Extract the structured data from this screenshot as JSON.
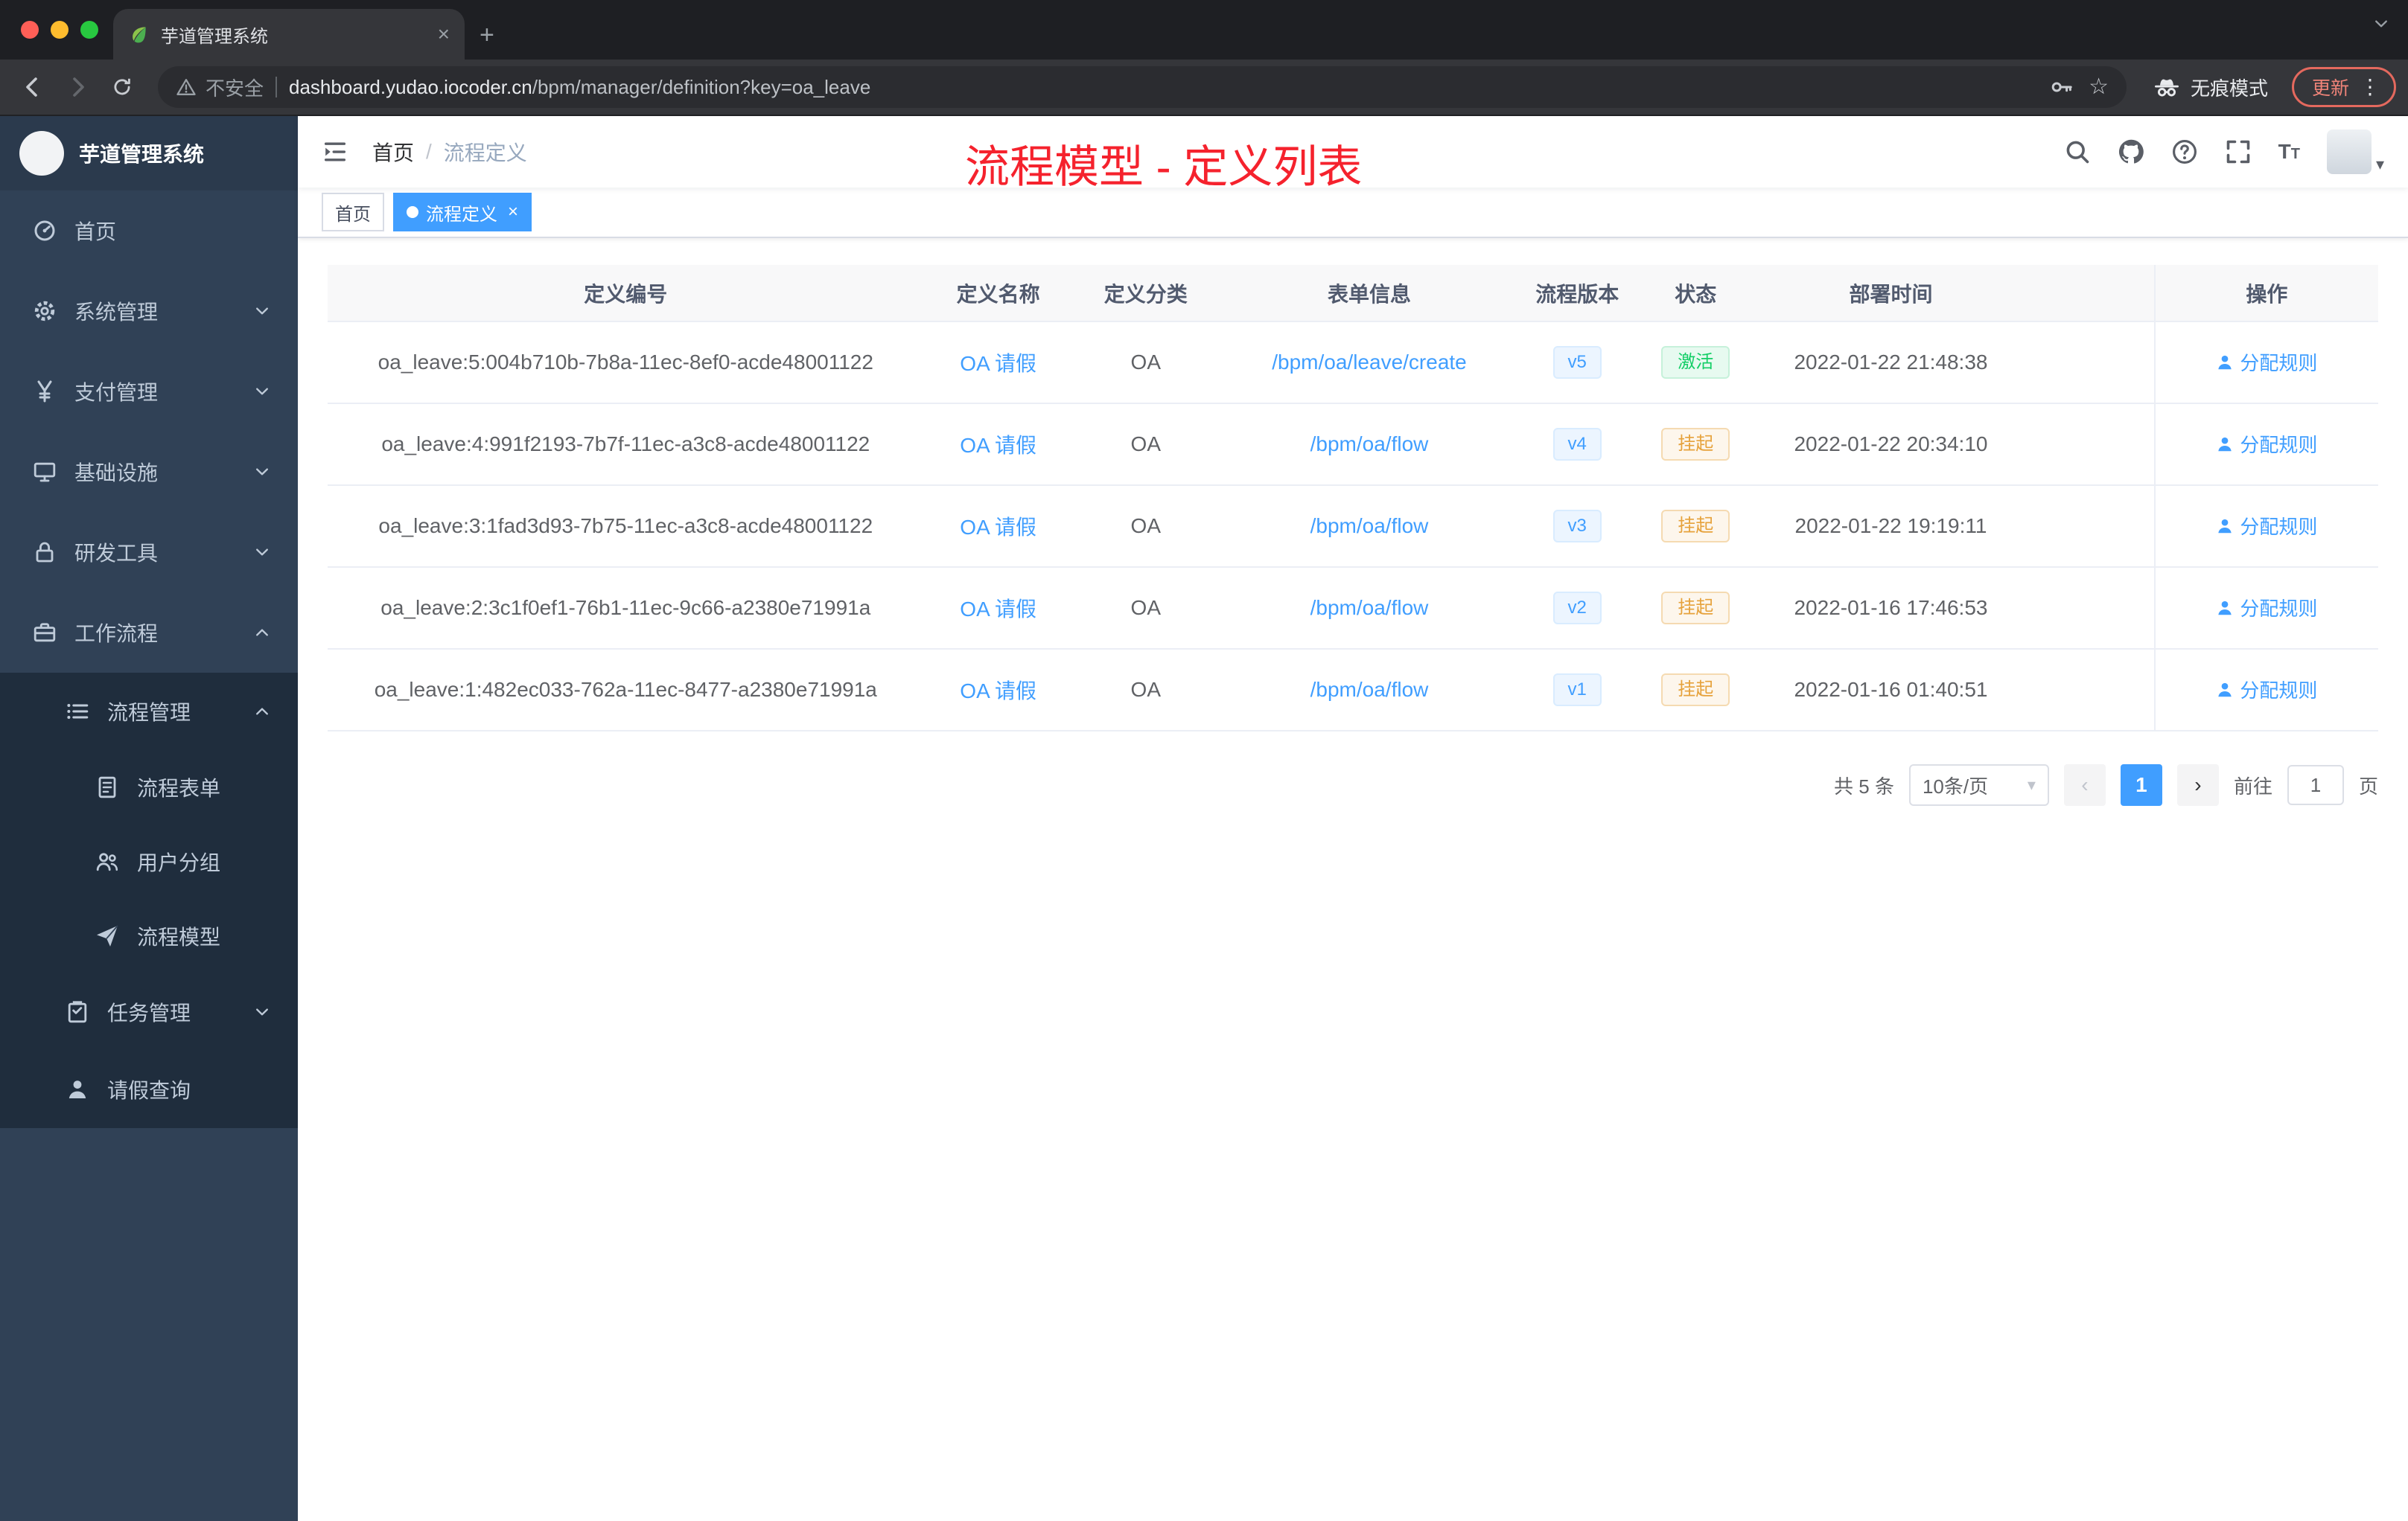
{
  "glyphs": {
    "close": "×",
    "plus": "+",
    "dots": "⋮",
    "star": "☆",
    "caret": "▾",
    "slash": "/",
    "prev": "‹",
    "next": "›",
    "t_big": "T",
    "t_small": "T"
  },
  "browser": {
    "tab_title": "芋道管理系统",
    "security": "不安全",
    "url_host": "dashboard.yudao.iocoder.cn",
    "url_path": "/bpm/manager/definition?key=oa_leave",
    "incognito": "无痕模式",
    "update": "更新"
  },
  "sidebar": {
    "logo_title": "芋道管理系统",
    "menu": [
      {
        "label": "首页",
        "icon": "dashboard-icon"
      },
      {
        "label": "系统管理",
        "icon": "gear-icon"
      },
      {
        "label": "支付管理",
        "icon": "yen-icon"
      },
      {
        "label": "基础设施",
        "icon": "infra-icon"
      },
      {
        "label": "研发工具",
        "icon": "tools-icon"
      },
      {
        "label": "工作流程",
        "icon": "workflow-icon"
      }
    ],
    "sub": [
      {
        "label": "流程管理",
        "icon": "list-icon"
      },
      {
        "label": "流程表单",
        "icon": "form-icon"
      },
      {
        "label": "用户分组",
        "icon": "users-icon"
      },
      {
        "label": "流程模型",
        "icon": "send-icon"
      },
      {
        "label": "任务管理",
        "icon": "task-icon"
      },
      {
        "label": "请假查询",
        "icon": "person-icon"
      }
    ]
  },
  "nav": {
    "breadcrumb_home": "首页",
    "breadcrumb_current": "流程定义"
  },
  "annotation": {
    "text": "流程模型 - 定义列表",
    "color": "#f5222d"
  },
  "tags": {
    "home": "首页",
    "active": "流程定义"
  },
  "table": {
    "columns": [
      "定义编号",
      "定义名称",
      "定义分类",
      "表单信息",
      "流程版本",
      "状态",
      "部署时间",
      "操作"
    ],
    "rows": [
      {
        "id": "oa_leave:5:004b710b-7b8a-11ec-8ef0-acde48001122",
        "name": "OA 请假",
        "category": "OA",
        "form": "/bpm/oa/leave/create",
        "version": "v5",
        "status": "激活",
        "status_type": "success",
        "time": "2022-01-22 21:48:38",
        "action": "分配规则"
      },
      {
        "id": "oa_leave:4:991f2193-7b7f-11ec-a3c8-acde48001122",
        "name": "OA 请假",
        "category": "OA",
        "form": "/bpm/oa/flow",
        "version": "v4",
        "status": "挂起",
        "status_type": "warning",
        "time": "2022-01-22 20:34:10",
        "action": "分配规则"
      },
      {
        "id": "oa_leave:3:1fad3d93-7b75-11ec-a3c8-acde48001122",
        "name": "OA 请假",
        "category": "OA",
        "form": "/bpm/oa/flow",
        "version": "v3",
        "status": "挂起",
        "status_type": "warning",
        "time": "2022-01-22 19:19:11",
        "action": "分配规则"
      },
      {
        "id": "oa_leave:2:3c1f0ef1-76b1-11ec-9c66-a2380e71991a",
        "name": "OA 请假",
        "category": "OA",
        "form": "/bpm/oa/flow",
        "version": "v2",
        "status": "挂起",
        "status_type": "warning",
        "time": "2022-01-16 17:46:53",
        "action": "分配规则"
      },
      {
        "id": "oa_leave:1:482ec033-762a-11ec-8477-a2380e71991a",
        "name": "OA 请假",
        "category": "OA",
        "form": "/bpm/oa/flow",
        "version": "v1",
        "status": "挂起",
        "status_type": "warning",
        "time": "2022-01-16 01:40:51",
        "action": "分配规则"
      }
    ]
  },
  "pagination": {
    "total": "共 5 条",
    "page_size": "10条/页",
    "page": "1",
    "goto": "前往",
    "goto_value": "1",
    "unit": "页"
  },
  "colors": {
    "accent": "#409eff",
    "annotation": "#f5222d",
    "sidebar_bg": "#304156",
    "submenu_bg": "#1f2d3d",
    "success": "#13ce66",
    "warning": "#e6a23c"
  }
}
